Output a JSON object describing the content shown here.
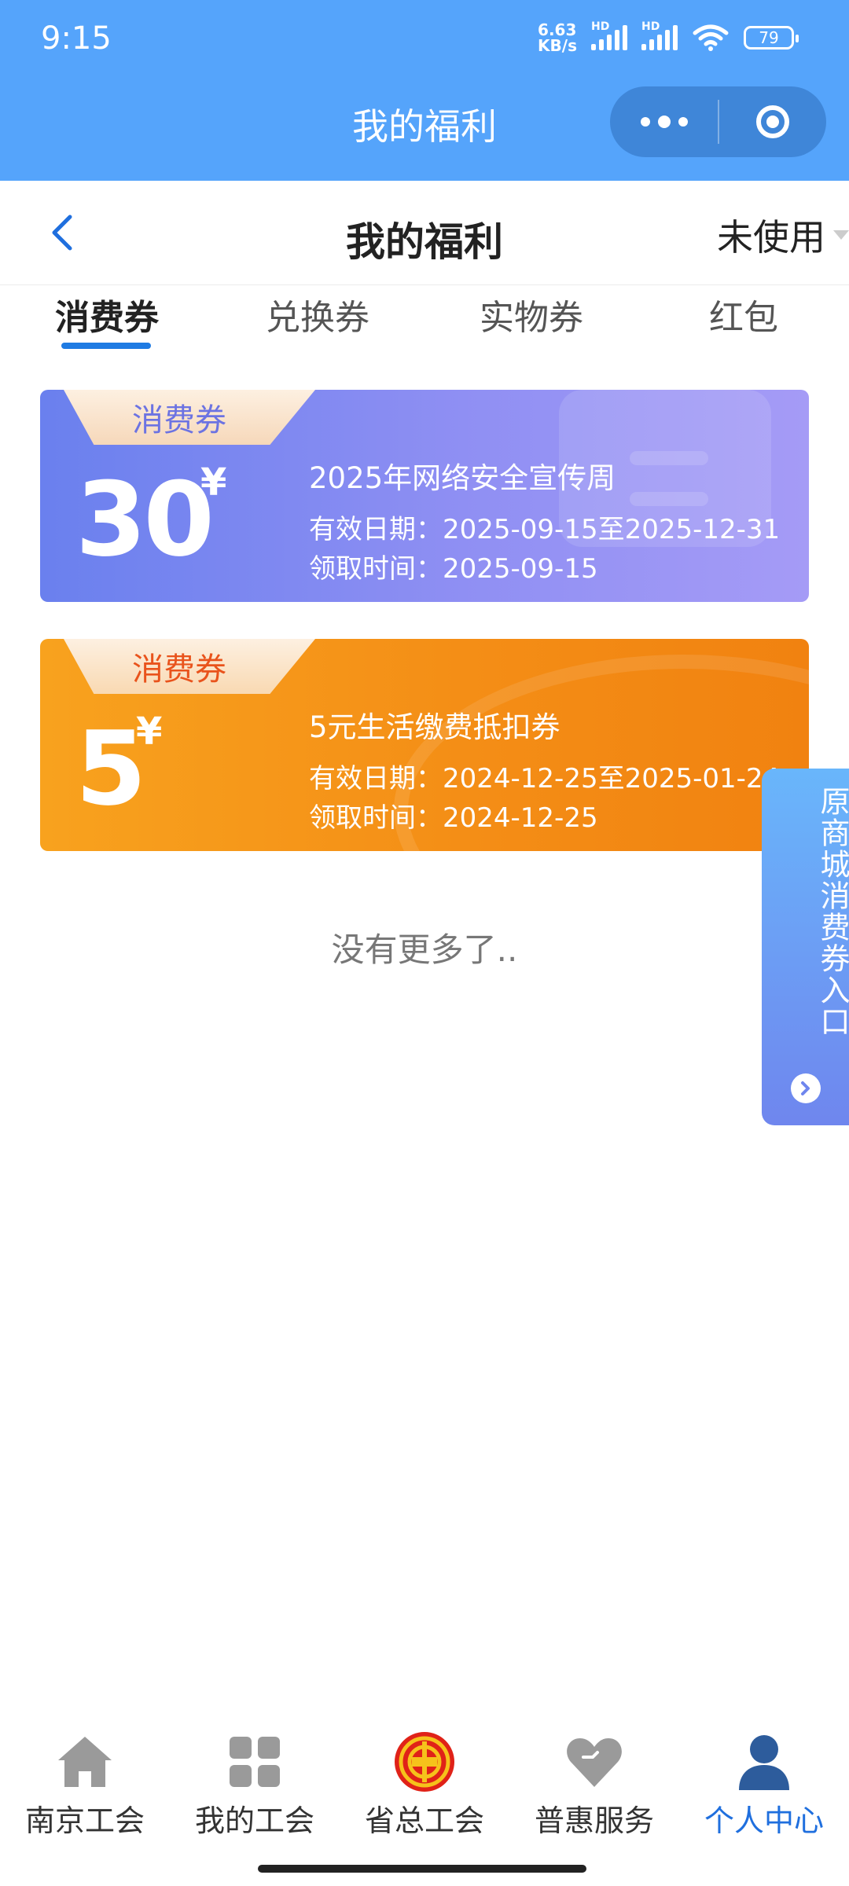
{
  "status_bar": {
    "time": "9:15",
    "net_speed_value": "6.63",
    "net_speed_unit": "KB/s",
    "signal_1_label": "HD",
    "signal_2_label": "HD",
    "battery": "79"
  },
  "mini_program": {
    "title": "我的福利"
  },
  "nav": {
    "title": "我的福利",
    "filter": "未使用"
  },
  "tabs": [
    {
      "label": "消费券",
      "active": true
    },
    {
      "label": "兑换券",
      "active": false
    },
    {
      "label": "实物券",
      "active": false
    },
    {
      "label": "红包",
      "active": false
    }
  ],
  "coupons": [
    {
      "tag": "消费券",
      "amount": "30",
      "currency": "¥",
      "name": "2025年网络安全宣传周",
      "valid": "有效日期：2025-09-15至2025-12-31",
      "claimed": "领取时间：2025-09-15",
      "color": "#7f87f1"
    },
    {
      "tag": "消费券",
      "amount": "5",
      "currency": "¥",
      "name": "5元生活缴费抵扣券",
      "valid": "有效日期：2024-12-25至2025-01-24",
      "claimed": "领取时间：2024-12-25",
      "color": "#f5911a"
    }
  ],
  "no_more": "没有更多了..",
  "side_entry": {
    "label": "原商城消费券入口",
    "icon": "chevron-right-icon"
  },
  "tabbar": [
    {
      "label": "南京工会",
      "icon": "home-icon",
      "active": false
    },
    {
      "label": "我的工会",
      "icon": "grid-icon",
      "active": false
    },
    {
      "label": "省总工会",
      "icon": "union-emblem-icon",
      "active": false
    },
    {
      "label": "普惠服务",
      "icon": "heart-icon",
      "active": false
    },
    {
      "label": "个人中心",
      "icon": "user-icon",
      "active": true
    }
  ],
  "colors": {
    "header_blue": "#55a4fb",
    "accent_blue": "#1f6fde",
    "tab_underline": "#1f7be3"
  }
}
